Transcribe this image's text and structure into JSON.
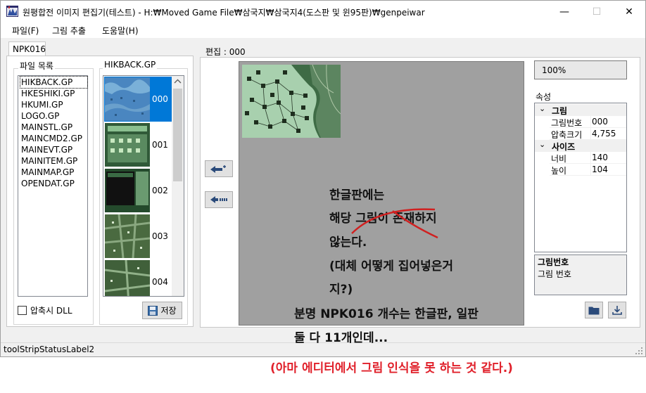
{
  "window": {
    "title": "원평합전 이미지 편집기(테스트) - H:₩Moved Game File₩삼국지₩삼국지4(도스판 및 윈95판)₩genpeiwar",
    "minimize": "—",
    "maximize": "☐",
    "close": "✕"
  },
  "menu": [
    "파일(F)",
    "그림 추출",
    "도움말(H)"
  ],
  "tab": "NPK016",
  "file_list": {
    "label": "파일 목록",
    "items": [
      "HIKBACK.GP",
      "HKESHIKI.GP",
      "HKUMI.GP",
      "LOGO.GP",
      "MAINSTL.GP",
      "MAINCMD2.GP",
      "MAINEVT.GP",
      "MAINITEM.GP",
      "MAINMAP.GP",
      "OPENDAT.GP"
    ],
    "selected_index": 0
  },
  "compress_dll": {
    "label": "압축시 DLL",
    "checked": false
  },
  "thumbnails": {
    "label": "HIKBACK.GP",
    "items": [
      "000",
      "001",
      "002",
      "003",
      "004"
    ],
    "selected_index": 0
  },
  "save_button": "저장",
  "editor": {
    "label": "편집 : 000",
    "zoom": "100%"
  },
  "properties": {
    "label": "속성",
    "categories": [
      {
        "name": "그림",
        "rows": [
          {
            "key": "그림번호",
            "value": "000"
          },
          {
            "key": "압축크기",
            "value": "4,755"
          }
        ]
      },
      {
        "name": "사이즈",
        "rows": [
          {
            "key": "너비",
            "value": "140"
          },
          {
            "key": "높이",
            "value": "104"
          }
        ]
      }
    ],
    "description_title": "그림번호",
    "description_text": "그림 번호"
  },
  "status": "toolStripStatusLabel2",
  "annotations": {
    "lines": [
      "한글판에는",
      "해당 그림이 존재하지",
      "않는다.",
      "(대체 어떻게 집어넣은거",
      "지?)",
      "분명 NPK016 개수는 한글판, 일판",
      "둘 다 11개인데..."
    ],
    "red": "(아마 에디터에서 그림 인식을 못 하는 것 같다.)"
  },
  "icons": {
    "app": "app-flag-icon",
    "save": "floppy-disk-icon",
    "import": "arrow-left-plus-icon",
    "export": "arrow-left-dots-icon",
    "open_folder": "folder-icon",
    "download": "download-icon"
  },
  "colors": {
    "selection": "#0078d7",
    "canvas": "#a0a0a0",
    "annotation_red": "#e0202a"
  }
}
